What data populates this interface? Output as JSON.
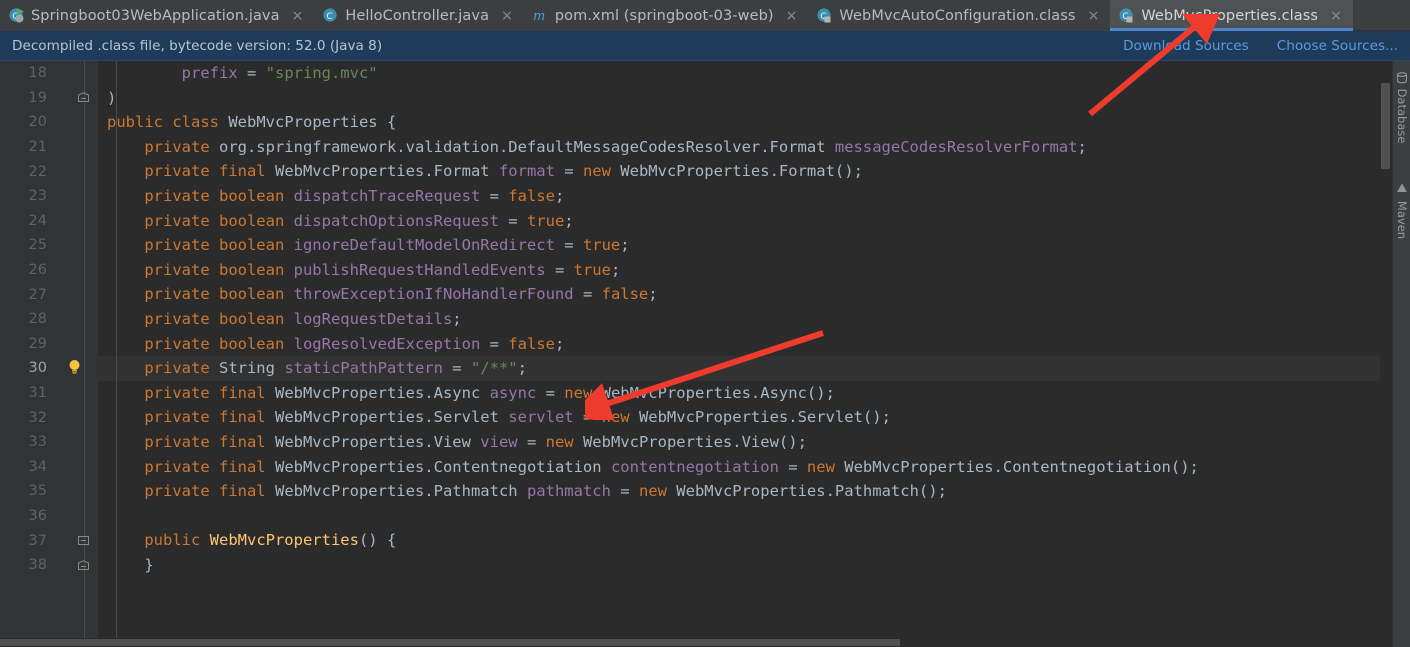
{
  "tabs": [
    {
      "label": "Springboot03WebApplication.java",
      "icon": "java-class-run-icon",
      "active": false,
      "close": "×"
    },
    {
      "label": "HelloController.java",
      "icon": "java-class-icon",
      "active": false,
      "close": "×"
    },
    {
      "label": "pom.xml (springboot-03-web)",
      "icon": "maven-icon",
      "active": false,
      "close": "×"
    },
    {
      "label": "WebMvcAutoConfiguration.class",
      "icon": "java-class-readonly-icon",
      "active": false,
      "close": "×"
    },
    {
      "label": "WebMvcProperties.class",
      "icon": "java-class-readonly-icon",
      "active": true,
      "close": "×"
    }
  ],
  "notice": {
    "text": "Decompiled .class file, bytecode version: 52.0 (Java 8)",
    "download_sources": "Download Sources",
    "choose_sources": "Choose Sources..."
  },
  "editor": {
    "first_line": 18,
    "current_line": 30,
    "lines": [
      {
        "n": 18,
        "fold": "none",
        "bulb": false,
        "tokens": [
          {
            "t": "        ",
            "c": "pun"
          },
          {
            "t": "prefix",
            "c": "fld"
          },
          {
            "t": " = ",
            "c": "pun"
          },
          {
            "t": "\"spring.mvc\"",
            "c": "str"
          }
        ]
      },
      {
        "n": 19,
        "fold": "end",
        "bulb": false,
        "tokens": [
          {
            "t": ")",
            "c": "pun"
          }
        ]
      },
      {
        "n": 20,
        "fold": "none",
        "bulb": false,
        "tokens": [
          {
            "t": "public class ",
            "c": "kw"
          },
          {
            "t": "WebMvcProperties",
            "c": "typ"
          },
          {
            "t": " {",
            "c": "pun"
          }
        ]
      },
      {
        "n": 21,
        "fold": "none",
        "bulb": false,
        "tokens": [
          {
            "t": "    ",
            "c": "pun"
          },
          {
            "t": "private ",
            "c": "kw"
          },
          {
            "t": "org.springframework.validation.DefaultMessageCodesResolver.Format ",
            "c": "typ"
          },
          {
            "t": "messageCodesResolverFormat",
            "c": "fld"
          },
          {
            "t": ";",
            "c": "pun"
          }
        ]
      },
      {
        "n": 22,
        "fold": "none",
        "bulb": false,
        "tokens": [
          {
            "t": "    ",
            "c": "pun"
          },
          {
            "t": "private final ",
            "c": "kw"
          },
          {
            "t": "WebMvcProperties.Format ",
            "c": "typ"
          },
          {
            "t": "format",
            "c": "fld"
          },
          {
            "t": " = ",
            "c": "pun"
          },
          {
            "t": "new ",
            "c": "kw"
          },
          {
            "t": "WebMvcProperties.Format();",
            "c": "typ"
          }
        ]
      },
      {
        "n": 23,
        "fold": "none",
        "bulb": false,
        "tokens": [
          {
            "t": "    ",
            "c": "pun"
          },
          {
            "t": "private boolean ",
            "c": "kw"
          },
          {
            "t": "dispatchTraceRequest",
            "c": "fld"
          },
          {
            "t": " = ",
            "c": "pun"
          },
          {
            "t": "false",
            "c": "kw"
          },
          {
            "t": ";",
            "c": "pun"
          }
        ]
      },
      {
        "n": 24,
        "fold": "none",
        "bulb": false,
        "tokens": [
          {
            "t": "    ",
            "c": "pun"
          },
          {
            "t": "private boolean ",
            "c": "kw"
          },
          {
            "t": "dispatchOptionsRequest",
            "c": "fld"
          },
          {
            "t": " = ",
            "c": "pun"
          },
          {
            "t": "true",
            "c": "kw"
          },
          {
            "t": ";",
            "c": "pun"
          }
        ]
      },
      {
        "n": 25,
        "fold": "none",
        "bulb": false,
        "tokens": [
          {
            "t": "    ",
            "c": "pun"
          },
          {
            "t": "private boolean ",
            "c": "kw"
          },
          {
            "t": "ignoreDefaultModelOnRedirect",
            "c": "fld"
          },
          {
            "t": " = ",
            "c": "pun"
          },
          {
            "t": "true",
            "c": "kw"
          },
          {
            "t": ";",
            "c": "pun"
          }
        ]
      },
      {
        "n": 26,
        "fold": "none",
        "bulb": false,
        "tokens": [
          {
            "t": "    ",
            "c": "pun"
          },
          {
            "t": "private boolean ",
            "c": "kw"
          },
          {
            "t": "publishRequestHandledEvents",
            "c": "fld"
          },
          {
            "t": " = ",
            "c": "pun"
          },
          {
            "t": "true",
            "c": "kw"
          },
          {
            "t": ";",
            "c": "pun"
          }
        ]
      },
      {
        "n": 27,
        "fold": "none",
        "bulb": false,
        "tokens": [
          {
            "t": "    ",
            "c": "pun"
          },
          {
            "t": "private boolean ",
            "c": "kw"
          },
          {
            "t": "throwExceptionIfNoHandlerFound",
            "c": "fld"
          },
          {
            "t": " = ",
            "c": "pun"
          },
          {
            "t": "false",
            "c": "kw"
          },
          {
            "t": ";",
            "c": "pun"
          }
        ]
      },
      {
        "n": 28,
        "fold": "none",
        "bulb": false,
        "tokens": [
          {
            "t": "    ",
            "c": "pun"
          },
          {
            "t": "private boolean ",
            "c": "kw"
          },
          {
            "t": "logRequestDetails",
            "c": "fld"
          },
          {
            "t": ";",
            "c": "pun"
          }
        ]
      },
      {
        "n": 29,
        "fold": "none",
        "bulb": false,
        "tokens": [
          {
            "t": "    ",
            "c": "pun"
          },
          {
            "t": "private boolean ",
            "c": "kw"
          },
          {
            "t": "logResolvedException",
            "c": "fld"
          },
          {
            "t": " = ",
            "c": "pun"
          },
          {
            "t": "false",
            "c": "kw"
          },
          {
            "t": ";",
            "c": "pun"
          }
        ]
      },
      {
        "n": 30,
        "fold": "none",
        "bulb": true,
        "tokens": [
          {
            "t": "    ",
            "c": "pun"
          },
          {
            "t": "private ",
            "c": "kw"
          },
          {
            "t": "String ",
            "c": "typ"
          },
          {
            "t": "staticPathPattern",
            "c": "fld"
          },
          {
            "t": " = ",
            "c": "pun"
          },
          {
            "t": "\"/**\"",
            "c": "str"
          },
          {
            "t": ";",
            "c": "pun"
          }
        ]
      },
      {
        "n": 31,
        "fold": "none",
        "bulb": false,
        "tokens": [
          {
            "t": "    ",
            "c": "pun"
          },
          {
            "t": "private final ",
            "c": "kw"
          },
          {
            "t": "WebMvcProperties.Async ",
            "c": "typ"
          },
          {
            "t": "async",
            "c": "fld"
          },
          {
            "t": " = ",
            "c": "pun"
          },
          {
            "t": "new ",
            "c": "kw"
          },
          {
            "t": "WebMvcProperties.Async();",
            "c": "typ"
          }
        ]
      },
      {
        "n": 32,
        "fold": "none",
        "bulb": false,
        "tokens": [
          {
            "t": "    ",
            "c": "pun"
          },
          {
            "t": "private final ",
            "c": "kw"
          },
          {
            "t": "WebMvcProperties.Servlet ",
            "c": "typ"
          },
          {
            "t": "servlet",
            "c": "fld"
          },
          {
            "t": " = ",
            "c": "pun"
          },
          {
            "t": "new ",
            "c": "kw"
          },
          {
            "t": "WebMvcProperties.Servlet();",
            "c": "typ"
          }
        ]
      },
      {
        "n": 33,
        "fold": "none",
        "bulb": false,
        "tokens": [
          {
            "t": "    ",
            "c": "pun"
          },
          {
            "t": "private final ",
            "c": "kw"
          },
          {
            "t": "WebMvcProperties.View ",
            "c": "typ"
          },
          {
            "t": "view",
            "c": "fld"
          },
          {
            "t": " = ",
            "c": "pun"
          },
          {
            "t": "new ",
            "c": "kw"
          },
          {
            "t": "WebMvcProperties.View();",
            "c": "typ"
          }
        ]
      },
      {
        "n": 34,
        "fold": "none",
        "bulb": false,
        "tokens": [
          {
            "t": "    ",
            "c": "pun"
          },
          {
            "t": "private final ",
            "c": "kw"
          },
          {
            "t": "WebMvcProperties.Contentnegotiation ",
            "c": "typ"
          },
          {
            "t": "contentnegotiation",
            "c": "fld"
          },
          {
            "t": " = ",
            "c": "pun"
          },
          {
            "t": "new ",
            "c": "kw"
          },
          {
            "t": "WebMvcProperties.Contentnegotiation();",
            "c": "typ"
          }
        ]
      },
      {
        "n": 35,
        "fold": "none",
        "bulb": false,
        "tokens": [
          {
            "t": "    ",
            "c": "pun"
          },
          {
            "t": "private final ",
            "c": "kw"
          },
          {
            "t": "WebMvcProperties.Pathmatch ",
            "c": "typ"
          },
          {
            "t": "pathmatch",
            "c": "fld"
          },
          {
            "t": " = ",
            "c": "pun"
          },
          {
            "t": "new ",
            "c": "kw"
          },
          {
            "t": "WebMvcProperties.Pathmatch();",
            "c": "typ"
          }
        ]
      },
      {
        "n": 36,
        "fold": "none",
        "bulb": false,
        "tokens": [
          {
            "t": "",
            "c": "pun"
          }
        ]
      },
      {
        "n": 37,
        "fold": "start",
        "bulb": false,
        "tokens": [
          {
            "t": "    ",
            "c": "pun"
          },
          {
            "t": "public ",
            "c": "kw"
          },
          {
            "t": "WebMvcProperties",
            "c": "mth"
          },
          {
            "t": "() {",
            "c": "pun"
          }
        ]
      },
      {
        "n": 38,
        "fold": "end",
        "bulb": false,
        "tokens": [
          {
            "t": "    }",
            "c": "pun"
          }
        ]
      }
    ]
  },
  "toolwindows": [
    {
      "label": "Database",
      "icon": "database-icon"
    },
    {
      "label": "Maven",
      "icon": "maven-icon"
    }
  ],
  "annotations": [
    {
      "name": "arrow-to-active-tab",
      "color": "#ef3b2d"
    },
    {
      "name": "arrow-to-static-path-pattern",
      "color": "#ef3b2d"
    }
  ],
  "colors": {
    "editor_bg": "#2b2b2b",
    "gutter_bg": "#313335",
    "tab_bg": "#3c3f41",
    "tab_active_bg": "#4e5254",
    "tab_underline": "#4a88c7",
    "notice_bg": "#1e3c5a",
    "link": "#5a9ae0",
    "keyword": "#cc7832",
    "field": "#9876aa",
    "string": "#6a8759",
    "method": "#ffc66d",
    "text": "#a9b7c6",
    "arrow": "#ef3b2d"
  }
}
